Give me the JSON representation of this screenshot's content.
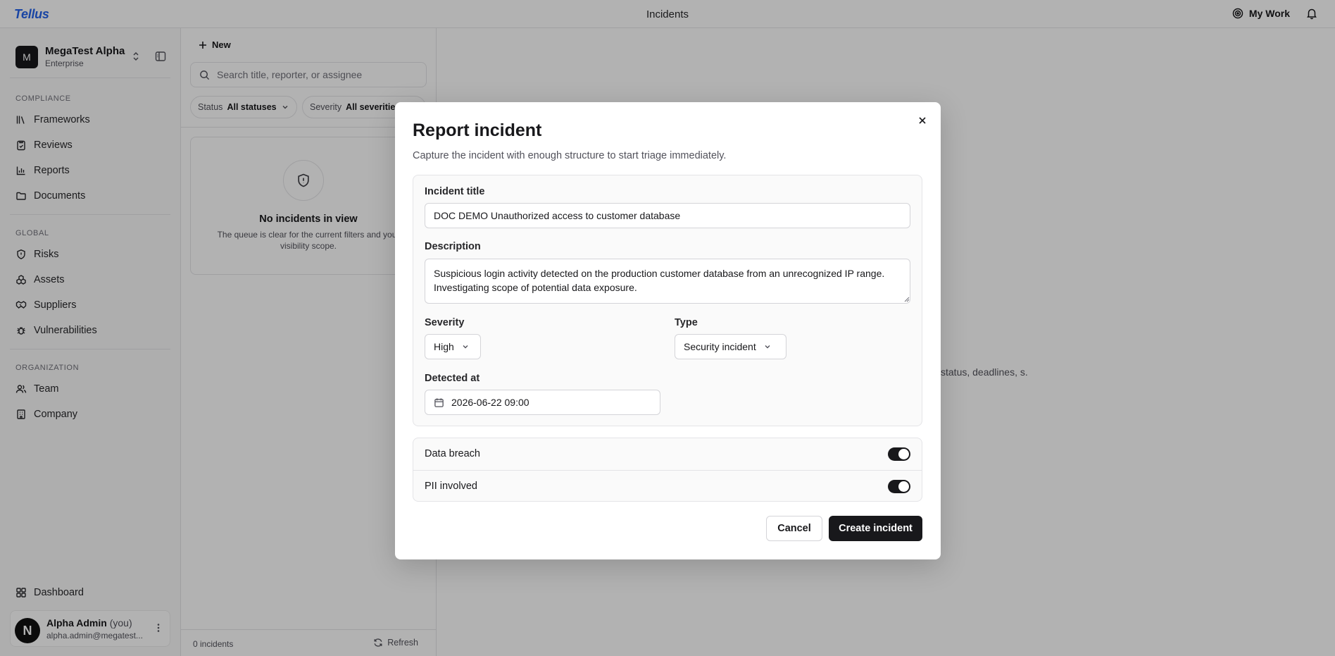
{
  "topbar": {
    "logo": "Tellus",
    "title": "Incidents",
    "my_work": "My Work"
  },
  "sidebar": {
    "org_initial": "M",
    "org_name": "MegaTest Alpha",
    "org_plan": "Enterprise",
    "sections": {
      "compliance": "COMPLIANCE",
      "global": "GLOBAL",
      "organization": "ORGANIZATION"
    },
    "items": {
      "frameworks": "Frameworks",
      "reviews": "Reviews",
      "reports": "Reports",
      "documents": "Documents",
      "risks": "Risks",
      "assets": "Assets",
      "suppliers": "Suppliers",
      "vulnerabilities": "Vulnerabilities",
      "team": "Team",
      "company": "Company",
      "dashboard": "Dashboard"
    },
    "user": {
      "initial": "N",
      "name": "Alpha Admin",
      "you": "(you)",
      "email": "alpha.admin@megatest..."
    }
  },
  "list": {
    "new_label": "New",
    "search_placeholder": "Search title, reporter, or assignee",
    "filters": {
      "status_key": "Status",
      "status_value": "All statuses",
      "severity_key": "Severity",
      "severity_value": "All severities"
    },
    "empty_title": "No incidents in view",
    "empty_desc": "The queue is clear for the current filters and your visibility scope.",
    "count": "0 incidents",
    "refresh": "Refresh"
  },
  "main": {
    "hint": "status, deadlines, s."
  },
  "modal": {
    "title": "Report incident",
    "subtitle": "Capture the incident with enough structure to start triage immediately.",
    "title_label": "Incident title",
    "title_value": "DOC DEMO Unauthorized access to customer database",
    "description_label": "Description",
    "description_value": "Suspicious login activity detected on the production customer database from an unrecognized IP range. Investigating scope of potential data exposure.",
    "severity_label": "Severity",
    "severity_value": "High",
    "type_label": "Type",
    "type_value": "Security incident",
    "detected_label": "Detected at",
    "detected_value": "2026-06-22 09:00",
    "data_breach_label": "Data breach",
    "data_breach_on": true,
    "pii_label": "PII involved",
    "pii_on": true,
    "cancel_label": "Cancel",
    "create_label": "Create incident"
  },
  "colors": {
    "brand": "#2563eb",
    "primary": "#18181b",
    "overlay": "rgba(0,0,0,0.30)"
  }
}
